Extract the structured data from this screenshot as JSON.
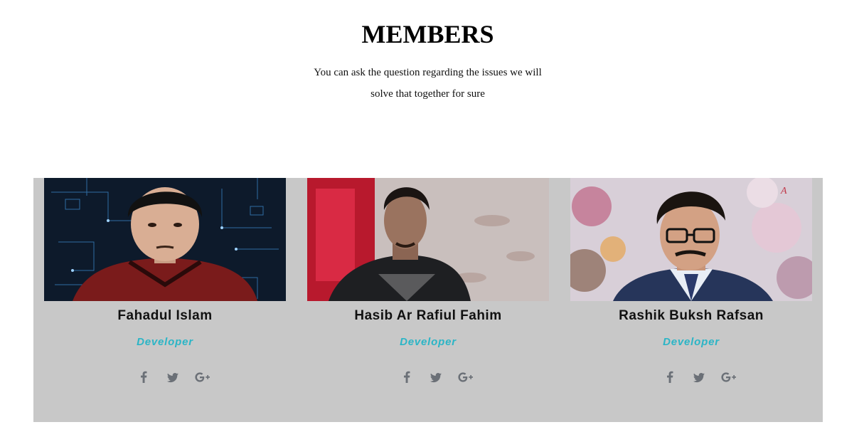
{
  "section": {
    "title": "MEMBERS",
    "subtitle_line1": "You can ask the question regarding the issues we will",
    "subtitle_line2": "solve that together for sure"
  },
  "members": [
    {
      "name": "Fahadul Islam",
      "role": "Developer"
    },
    {
      "name": "Hasib Ar Rafiul Fahim",
      "role": "Developer"
    },
    {
      "name": "Rashik Buksh Rafsan",
      "role": "Developer"
    }
  ],
  "social_icons": [
    "facebook-icon",
    "twitter-icon",
    "google-plus-icon"
  ],
  "colors": {
    "panel": "#c8c8c8",
    "role": "#2bb5c6",
    "icon": "#6b7077"
  }
}
